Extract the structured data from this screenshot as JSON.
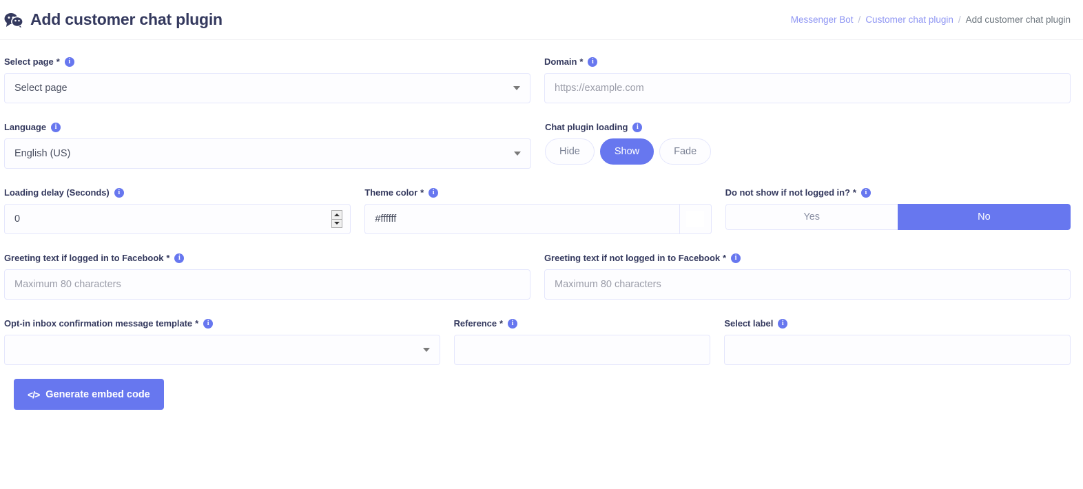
{
  "header": {
    "title": "Add customer chat plugin",
    "title_icon": "chat-bubbles-icon",
    "breadcrumb": {
      "item1": "Messenger Bot",
      "sep1": "/",
      "item2": "Customer chat plugin",
      "sep2": "/",
      "current": "Add customer chat plugin"
    }
  },
  "form": {
    "select_page": {
      "label": "Select page",
      "required": "*",
      "info": "i",
      "value": "Select page"
    },
    "domain": {
      "label": "Domain",
      "required": "*",
      "info": "i",
      "placeholder": "https://example.com",
      "value": ""
    },
    "language": {
      "label": "Language",
      "info": "i",
      "value": "English (US)"
    },
    "chat_plugin_loading": {
      "label": "Chat plugin loading",
      "info": "i",
      "options": [
        "Hide",
        "Show",
        "Fade"
      ],
      "selected": "Show"
    },
    "loading_delay": {
      "label": "Loading delay (Seconds)",
      "info": "i",
      "value": "0"
    },
    "theme_color": {
      "label": "Theme color",
      "required": "*",
      "info": "i",
      "value": "#ffffff",
      "swatch_color": "#ffffff"
    },
    "not_logged_in": {
      "label": "Do not show if not logged in?",
      "required": "*",
      "info": "i",
      "options": [
        "Yes",
        "No"
      ],
      "selected": "No"
    },
    "greeting_logged_in": {
      "label": "Greeting text if logged in to Facebook",
      "required": "*",
      "info": "i",
      "placeholder": "Maximum 80 characters",
      "value": ""
    },
    "greeting_not_logged_in": {
      "label": "Greeting text if not logged in to Facebook",
      "required": "*",
      "info": "i",
      "placeholder": "Maximum 80 characters",
      "value": ""
    },
    "optin_template": {
      "label": "Opt-in inbox confirmation message template",
      "required": "*",
      "info": "i",
      "value": ""
    },
    "reference": {
      "label": "Reference",
      "required": "*",
      "info": "i",
      "placeholder": "",
      "value": ""
    },
    "select_label": {
      "label": "Select label",
      "info": "i",
      "placeholder": "",
      "value": ""
    }
  },
  "actions": {
    "generate": {
      "label": "Generate embed code",
      "icon": "code-icon"
    }
  },
  "colors": {
    "accent": "#6777ef",
    "title": "#34395e",
    "link": "#8e95f3",
    "border": "#e4e6fc"
  }
}
